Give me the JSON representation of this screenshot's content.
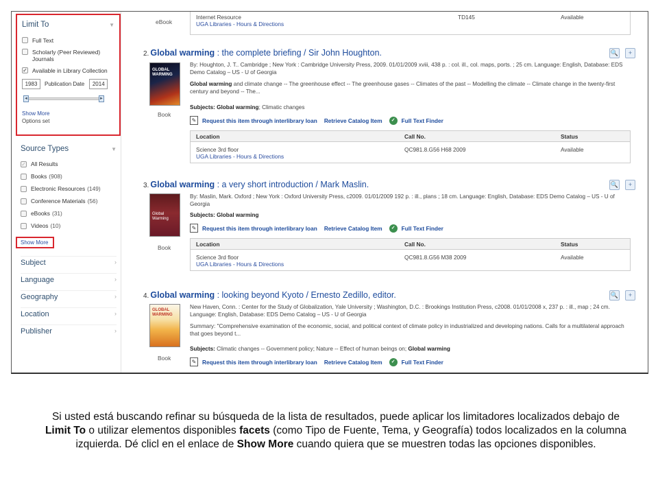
{
  "sidebar": {
    "limit_to": {
      "title": "Limit To",
      "options": [
        {
          "label": "Full Text",
          "checked": false
        },
        {
          "label": "Scholarly (Peer Reviewed) Journals",
          "checked": false
        },
        {
          "label": "Available in Library Collection",
          "checked": true
        }
      ],
      "date_from": "1983",
      "date_label": "Publication Date",
      "date_to": "2014",
      "show_more": "Show More",
      "options_set": "Options set"
    },
    "source_types": {
      "title": "Source Types",
      "items": [
        {
          "label": "All Results",
          "count": "",
          "checked": true
        },
        {
          "label": "Books",
          "count": "(908)",
          "checked": false
        },
        {
          "label": "Electronic Resources",
          "count": "(149)",
          "checked": false
        },
        {
          "label": "Conference Materials",
          "count": "(56)",
          "checked": false
        },
        {
          "label": "eBooks",
          "count": "(31)",
          "checked": false
        },
        {
          "label": "Videos",
          "count": "(10)",
          "checked": false
        }
      ],
      "show_more": "Show More"
    },
    "facets": [
      "Subject",
      "Language",
      "Geography",
      "Location",
      "Publisher"
    ]
  },
  "results": {
    "top_partial": {
      "type": "eBook",
      "location": "Internet Resource",
      "call_no": "TD145",
      "status": "Available",
      "link": "UGA Libraries - Hours & Directions"
    },
    "items": [
      {
        "num": "2.",
        "title_bold": "Global warming",
        "title_rest": " : the complete briefing / Sir John Houghton.",
        "by": "By: Houghton, J. T.. Cambridge ; New York : Cambridge University Press, 2009. 01/01/2009 xviii, 438 p. : col. ill., col. maps, ports. ; 25 cm. Language: English, Database: EDS Demo Catalog – US - U of Georgia",
        "summary_bold": "Global warming",
        "summary_rest": " and climate change -- The greenhouse effect -- The greenhouse gases -- Climates of the past -- Modelling the climate -- Climate change in the twenty-first century and beyond -- The...",
        "subjects_label": "Subjects:",
        "subjects_bold": "Global warming",
        "subjects_rest": "; Climatic changes",
        "type": "Book",
        "cover_text": "GLOBAL WARMING",
        "location": "Science 3rd floor",
        "call_no": "QC981.8.G56 H68 2009",
        "status": "Available",
        "link": "UGA Libraries - Hours & Directions"
      },
      {
        "num": "3.",
        "title_bold": "Global warming",
        "title_rest": " : a very short introduction / Mark Maslin.",
        "by": "By: Maslin, Mark. Oxford ; New York : Oxford University Press, c2009. 01/01/2009 192 p. : ill., plans ; 18 cm. Language: English, Database: EDS Demo Catalog – US - U of Georgia",
        "subjects_label": "Subjects:",
        "subjects_bold": "Global warming",
        "subjects_rest": "",
        "type": "Book",
        "cover_text": "Global Warming",
        "location": "Science 3rd floor",
        "call_no": "QC981.8.G56 M38 2009",
        "status": "Available",
        "link": "UGA Libraries - Hours & Directions"
      },
      {
        "num": "4.",
        "title_bold": "Global warming",
        "title_rest": " : looking beyond Kyoto / Ernesto Zedillo, editor.",
        "by": "New Haven, Conn. : Center for the Study of Globalization, Yale University ; Washington, D.C. : Brookings Institution Press, c2008. 01/01/2008 x, 237 p. : ill., map ; 24 cm. Language: English, Database: EDS Demo Catalog – US - U of Georgia",
        "summary_bold": "",
        "summary_rest": "Summary: \"Comprehensive examination of the economic, social, and political context of climate policy in industrialized and developing nations. Calls for a multilateral approach that goes beyond t...",
        "subjects_label": "Subjects:",
        "subjects_bold": "",
        "subjects_rest": "Climatic changes -- Government policy; Nature -- Effect of human beings on;",
        "subjects_bold2": "Global warming",
        "type": "Book",
        "cover_text": "GLOBAL WARMING"
      }
    ],
    "actions": {
      "request": "Request this item through interlibrary loan",
      "retrieve": "Retrieve Catalog Item",
      "fulltext": "Full Text Finder"
    },
    "holdings_headers": {
      "location": "Location",
      "call_no": "Call No.",
      "status": "Status"
    }
  },
  "caption": {
    "p1": "Si usted está buscando refinar su búsqueda de la lista de resultados, puede aplicar los limitadores localizados debajo de ",
    "limit_to": "Limit To",
    "p2": " o utilizar elementos disponibles ",
    "facets": "facets",
    "p3": " (como Tipo de Fuente, Tema, y Geografía) todos localizados en la columna izquierda. Dé clicl en el enlace de ",
    "show_more": "Show More",
    "p4": "  cuando quiera que se muestren todas las opciones disponibles."
  },
  "colors": {
    "highlight": "#d9262e",
    "link": "#1d4b9c",
    "panel_title": "#2f4f6f"
  }
}
